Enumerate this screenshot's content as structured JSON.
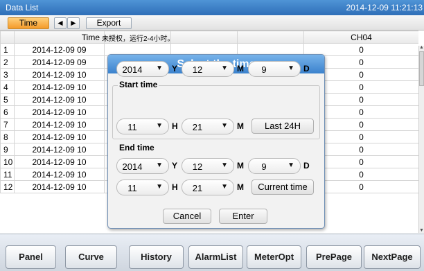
{
  "window": {
    "title": "Data List",
    "datetime": "2014-12-09 11:21:13"
  },
  "toolbar": {
    "time_label": "Time",
    "prev_glyph": "◄",
    "next_glyph": "►",
    "export_label": "Export"
  },
  "table": {
    "header_time": "Time",
    "header_ch04": "CH04",
    "unauthorized_notice": "未授权，运行2-4小时。",
    "rows": [
      {
        "index": "1",
        "time": "2014-12-09 09",
        "ch04": "0"
      },
      {
        "index": "2",
        "time": "2014-12-09 09",
        "ch04": "0"
      },
      {
        "index": "3",
        "time": "2014-12-09 10",
        "ch04": "0"
      },
      {
        "index": "4",
        "time": "2014-12-09 10",
        "ch04": "0"
      },
      {
        "index": "5",
        "time": "2014-12-09 10",
        "ch04": "0"
      },
      {
        "index": "6",
        "time": "2014-12-09 10",
        "ch04": "0"
      },
      {
        "index": "7",
        "time": "2014-12-09 10",
        "ch04": "0"
      },
      {
        "index": "8",
        "time": "2014-12-09 10",
        "ch04": "0"
      },
      {
        "index": "9",
        "time": "2014-12-09 10",
        "ch04": "0"
      },
      {
        "index": "10",
        "time": "2014-12-09 10",
        "ch04": "0"
      },
      {
        "index": "11",
        "time": "2014-12-09 10",
        "ch04": "0"
      },
      {
        "index": "12",
        "time": "2014-12-09 10",
        "ch04": "0"
      }
    ]
  },
  "dialog": {
    "title": "Select the time",
    "start": {
      "label": "Start time",
      "year": "2014",
      "month": "12",
      "day": "9",
      "hour": "11",
      "minute": "21",
      "quick_button": "Last 24H"
    },
    "end": {
      "label": "End time",
      "year": "2014",
      "month": "12",
      "day": "9",
      "hour": "11",
      "minute": "21",
      "quick_button": "Current time"
    },
    "units": {
      "year": "Y",
      "month": "M",
      "day": "D",
      "hour": "H",
      "minute": "M"
    },
    "dropdown_glyph": "▼",
    "cancel_label": "Cancel",
    "enter_label": "Enter"
  },
  "nav": {
    "panel": "Panel",
    "curve": "Curve",
    "history": "History",
    "alarmlist": "AlarmList",
    "meteropt": "MeterOpt",
    "prepage": "PrePage",
    "nextpage": "NextPage"
  },
  "colors": {
    "title_bar": "#3b82cd",
    "active_button": "#f49a2a"
  }
}
